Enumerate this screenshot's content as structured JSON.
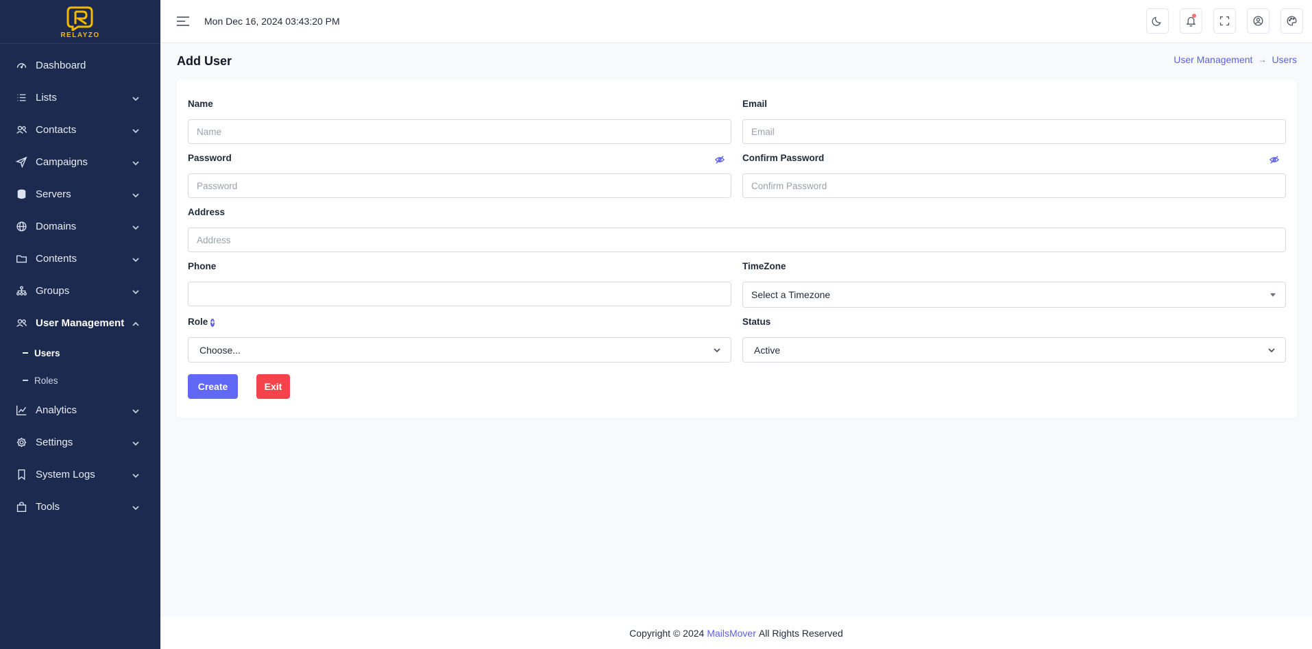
{
  "brand": {
    "name": "RELAYZO",
    "accent": "#f5b800",
    "sidebar_bg": "#1b2a4e",
    "primary": "#6168f6",
    "danger": "#f4434a"
  },
  "header": {
    "datetime": "Mon Dec 16, 2024 03:43:20 PM",
    "icons": [
      "moon-icon",
      "bell-icon",
      "fullscreen-icon",
      "user-circle-icon",
      "palette-icon"
    ]
  },
  "sidebar": {
    "items": [
      {
        "label": "Dashboard",
        "icon": "gauge-icon"
      },
      {
        "label": "Lists",
        "icon": "list-icon"
      },
      {
        "label": "Contacts",
        "icon": "contacts-icon"
      },
      {
        "label": "Campaigns",
        "icon": "send-icon"
      },
      {
        "label": "Servers",
        "icon": "database-icon"
      },
      {
        "label": "Domains",
        "icon": "globe-icon"
      },
      {
        "label": "Contents",
        "icon": "folder-icon"
      },
      {
        "label": "Groups",
        "icon": "hierarchy-icon"
      },
      {
        "label": "User Management",
        "icon": "users-icon"
      },
      {
        "label": "Analytics",
        "icon": "chart-icon"
      },
      {
        "label": "Settings",
        "icon": "gear-icon"
      },
      {
        "label": "System Logs",
        "icon": "bookmark-icon"
      },
      {
        "label": "Tools",
        "icon": "bag-icon"
      }
    ],
    "user_management_sub": [
      {
        "label": "Users"
      },
      {
        "label": "Roles"
      }
    ]
  },
  "page": {
    "title": "Add User",
    "breadcrumb": {
      "parent": "User Management",
      "arrow": "→",
      "current": "Users"
    }
  },
  "form": {
    "name": {
      "label": "Name",
      "placeholder": "Name"
    },
    "email": {
      "label": "Email",
      "placeholder": "Email"
    },
    "password": {
      "label": "Password",
      "placeholder": "Password"
    },
    "confirm_password": {
      "label": "Confirm Password",
      "placeholder": "Confirm Password"
    },
    "address": {
      "label": "Address",
      "placeholder": "Address"
    },
    "phone": {
      "label": "Phone",
      "placeholder": ""
    },
    "timezone": {
      "label": "TimeZone",
      "value": "Select a Timezone"
    },
    "role": {
      "label": "Role",
      "plus": "+",
      "value": "Choose..."
    },
    "status": {
      "label": "Status",
      "value": "Active"
    },
    "create_label": "Create",
    "exit_label": "Exit"
  },
  "footer": {
    "prefix": "Copyright © 2024",
    "link": "MailsMover",
    "suffix": "All Rights Reserved"
  }
}
